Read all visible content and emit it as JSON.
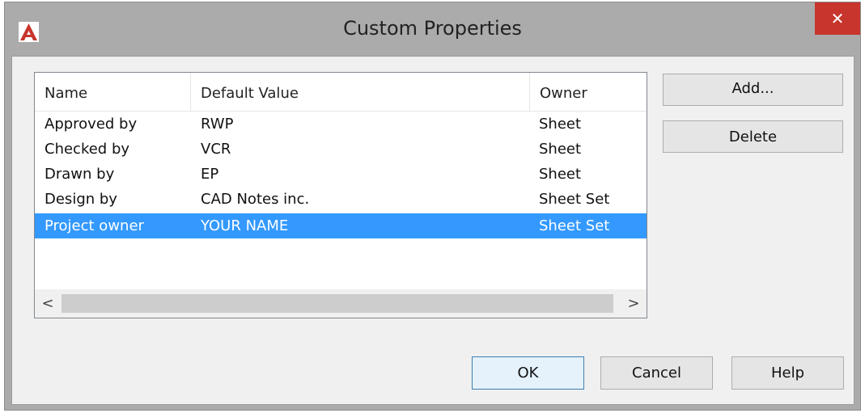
{
  "window": {
    "title": "Custom Properties",
    "close_glyph": "✕",
    "icon": "autocad-a-icon",
    "accent_color": "#c7352c"
  },
  "list": {
    "columns": [
      "Name",
      "Default Value",
      "Owner"
    ],
    "rows": [
      {
        "name": "Approved by",
        "value": "RWP",
        "owner": "Sheet"
      },
      {
        "name": "Checked by",
        "value": "VCR",
        "owner": "Sheet"
      },
      {
        "name": "Drawn by",
        "value": "EP",
        "owner": "Sheet"
      },
      {
        "name": "Design by",
        "value": "CAD Notes inc.",
        "owner": "Sheet Set"
      },
      {
        "name": "Project owner",
        "value": "YOUR NAME",
        "owner": "Sheet Set"
      }
    ],
    "selected_index": 4,
    "selection_color": "#3399ff",
    "scroll_left": "<",
    "scroll_right": ">"
  },
  "buttons": {
    "add": "Add...",
    "delete": "Delete",
    "ok": "OK",
    "cancel": "Cancel",
    "help": "Help"
  }
}
